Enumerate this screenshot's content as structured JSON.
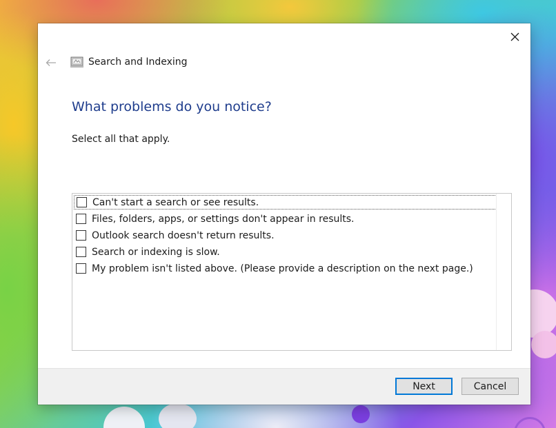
{
  "window": {
    "app_title": "Search and Indexing",
    "app_icon": "search-indexing-icon",
    "back_icon": "back-arrow-icon",
    "close_icon": "close-icon"
  },
  "page": {
    "heading": "What problems do you notice?",
    "instruction": "Select all that apply."
  },
  "options": [
    {
      "label": "Can't start a search or see results.",
      "checked": false,
      "focused": true
    },
    {
      "label": "Files, folders, apps, or settings don't appear in results.",
      "checked": false,
      "focused": false
    },
    {
      "label": "Outlook search doesn't return results.",
      "checked": false,
      "focused": false
    },
    {
      "label": "Search or indexing is slow.",
      "checked": false,
      "focused": false
    },
    {
      "label": "My problem isn't listed above. (Please provide a description on the next page.)",
      "checked": false,
      "focused": false
    }
  ],
  "buttons": {
    "next_label": "Next",
    "cancel_label": "Cancel"
  },
  "colors": {
    "heading": "#1e3c8c",
    "default_button_border": "#0078d7",
    "footer_background": "#f0f0f0"
  }
}
